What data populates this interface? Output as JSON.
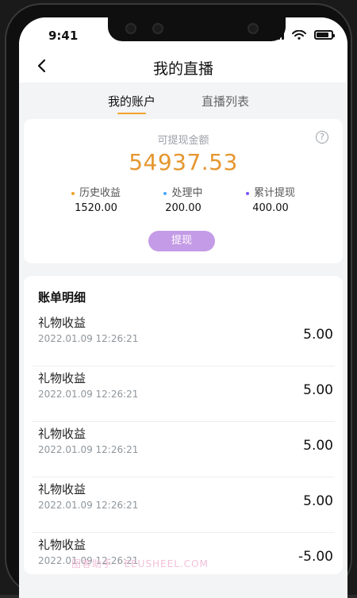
{
  "status_bar": {
    "time": "9:41"
  },
  "nav": {
    "title": "我的直播"
  },
  "tabs": [
    {
      "label": "我的账户",
      "active": true
    },
    {
      "label": "直播列表",
      "active": false
    }
  ],
  "account": {
    "available_label": "可提现金额",
    "amount": "54937.53",
    "help_glyph": "?",
    "stats": [
      {
        "label": "历史收益",
        "value": "1520.00",
        "dot": "#f0a12b"
      },
      {
        "label": "处理中",
        "value": "200.00",
        "dot": "#4aa8ff"
      },
      {
        "label": "累计提现",
        "value": "400.00",
        "dot": "#7b57ff"
      }
    ],
    "withdraw_label": "提现"
  },
  "details": {
    "title": "账单明细",
    "items": [
      {
        "title": "礼物收益",
        "time": "2022.01.09 12:26:21",
        "amount": "5.00"
      },
      {
        "title": "礼物收益",
        "time": "2022.01.09 12:26:21",
        "amount": "5.00"
      },
      {
        "title": "礼物收益",
        "time": "2022.01.09 12:26:21",
        "amount": "5.00"
      },
      {
        "title": "礼物收益",
        "time": "2022.01.09 12:26:21",
        "amount": "5.00"
      },
      {
        "title": "礼物收益",
        "time": "2022.01.09 12:26:21",
        "amount": "-5.00"
      }
    ]
  },
  "watermark": "图客助手 · EEUSHEEL.COM",
  "colors": {
    "accent": "#e5962f",
    "tab_underline": "#f0a12b",
    "withdraw_button": "#c49be6",
    "background": "#f3f4f6"
  },
  "icons": {
    "back": "chevron-left-icon",
    "help": "help-circle-icon"
  }
}
